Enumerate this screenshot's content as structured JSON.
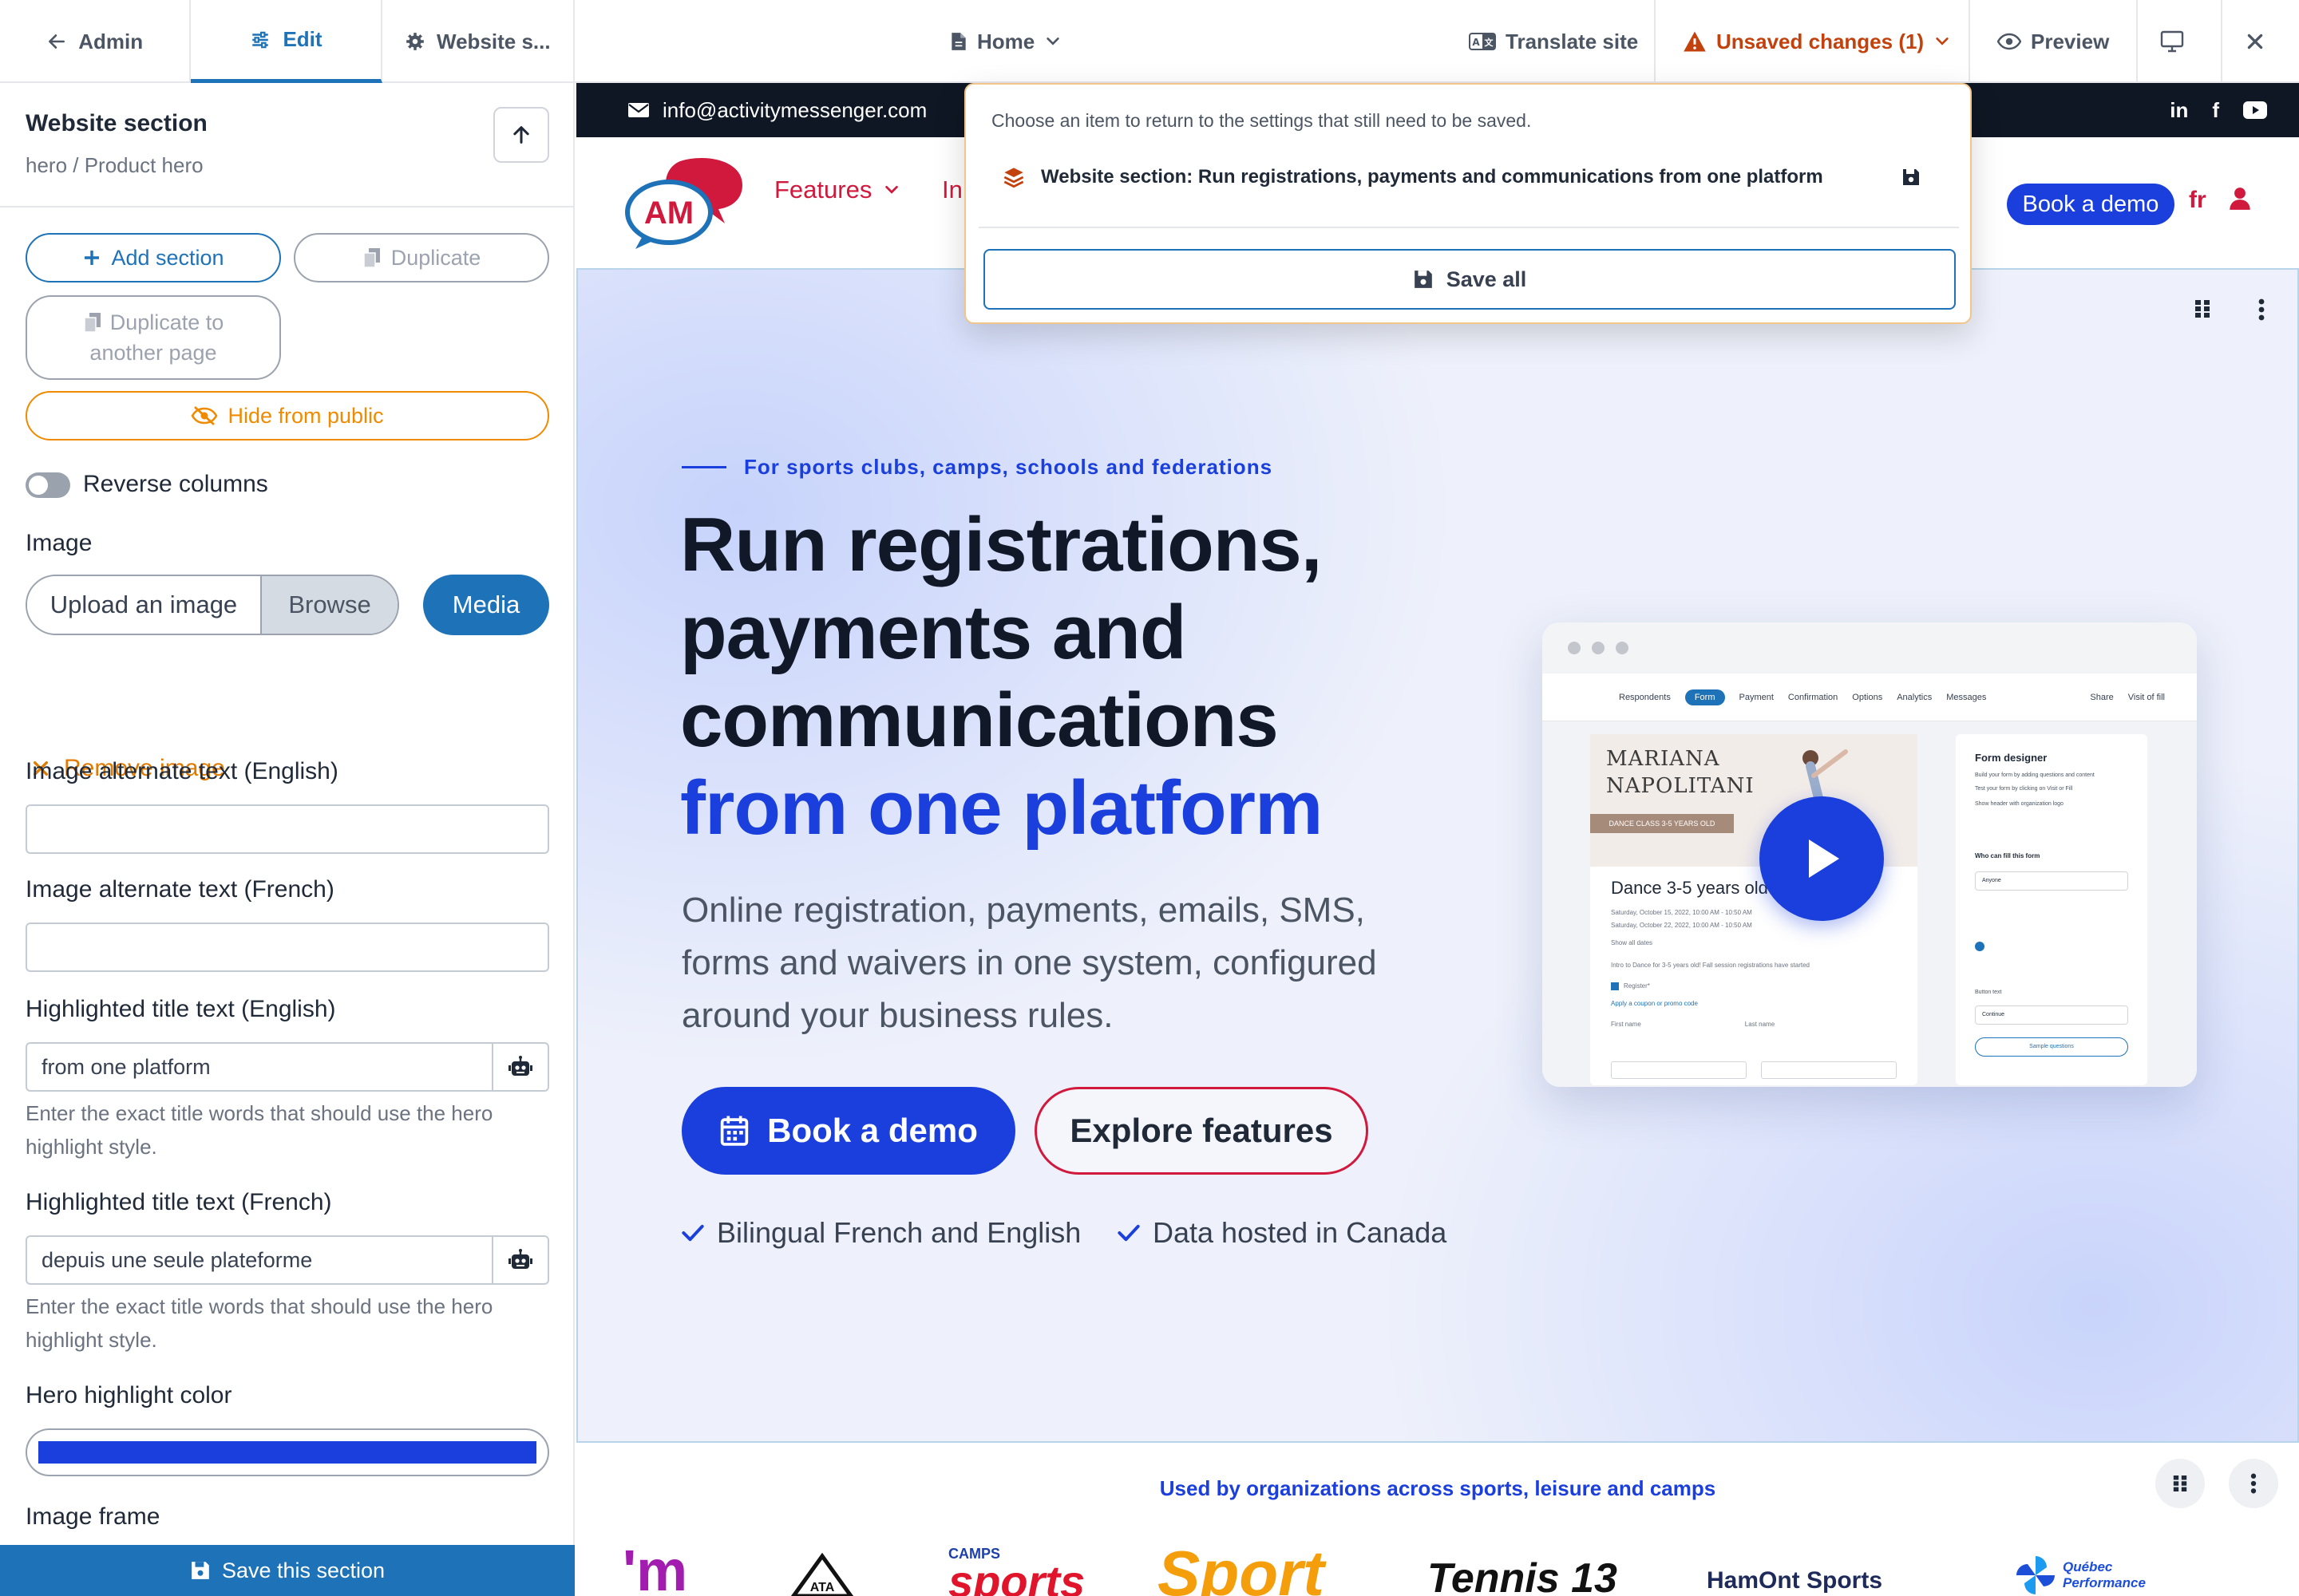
{
  "topbar": {
    "tabs": [
      {
        "label": "Admin",
        "icon": "arrow-left-icon"
      },
      {
        "label": "Edit",
        "icon": "sliders-icon"
      },
      {
        "label": "Website s...",
        "icon": "gear-icon"
      }
    ],
    "page_selector": "Home",
    "translate_label": "Translate site",
    "unsaved_label": "Unsaved changes (1)",
    "preview_label": "Preview"
  },
  "panel": {
    "title": "Website section",
    "subtitle": "hero / Product hero",
    "add_section": "Add section",
    "duplicate": "Duplicate",
    "duplicate_to_line1": "Duplicate to",
    "duplicate_to_line2": "another page",
    "hide_public": "Hide from public",
    "reverse_columns": "Reverse columns",
    "image_label": "Image",
    "upload_image": "Upload an image",
    "browse": "Browse",
    "media": "Media",
    "remove_image": "Remove image",
    "alt_en_label": "Image alternate text (English)",
    "alt_en_value": "",
    "alt_fr_label": "Image alternate text (French)",
    "alt_fr_value": "",
    "hl_en_label": "Highlighted title text (English)",
    "hl_en_value": "from one platform",
    "hl_help_line1": "Enter the exact title words that should use the hero",
    "hl_help_line2": "highlight style.",
    "hl_fr_label": "Highlighted title text (French)",
    "hl_fr_value": "depuis une seule plateforme",
    "color_label": "Hero highlight color",
    "color_value": "#1a3fdc",
    "frame_label": "Image frame",
    "save_section": "Save this section"
  },
  "site": {
    "email": "info@activitymessenger.com",
    "social": [
      "in",
      "f",
      "youtube-icon"
    ],
    "logo_text": "AM",
    "nav_features": "Features",
    "nav_in": "In",
    "nav_demo": "Book a demo",
    "nav_lang": "fr",
    "hero": {
      "eyebrow": "For sports clubs, camps, schools and federations",
      "title_line1": "Run registrations,",
      "title_line2": "payments and",
      "title_line3": "communications",
      "title_highlight": "from one platform",
      "desc_line1": "Online registration, payments, emails, SMS,",
      "desc_line2": "forms and waivers in one system, configured",
      "desc_line3": "around your business rules.",
      "cta_primary": "Book a demo",
      "cta_secondary": "Explore features",
      "check1": "Bilingual French and English",
      "check2": "Data hosted in Canada"
    },
    "mock": {
      "nav": [
        "Respondents",
        "Form",
        "Payment",
        "Confirmation",
        "Options",
        "Analytics",
        "Messages"
      ],
      "share": "Share",
      "visit": "Visit of fill",
      "card_name1": "MARIANA",
      "card_name2": "NAPOLITANI",
      "card_badge": "DANCE CLASS 3-5 YEARS OLD",
      "card_title": "Dance 3-5 years old",
      "card_date1": "Saturday, October 15, 2022, 10:00 AM - 10:50 AM",
      "card_date2": "Saturday, October 22, 2022, 10:00 AM - 10:50 AM",
      "show_all": "Show all dates",
      "intro": "Intro to Dance for 3-5 years old! Fall session registrations have started",
      "register": "Register*",
      "coupon": "Apply a coupon or promo code",
      "first_name": "First name",
      "last_name": "Last name",
      "side_title": "Form designer",
      "side_b1": "Build your form by adding questions and content",
      "side_b2": "Test your form by clicking on Visit or Fill",
      "side_b3": "Show header with organization logo",
      "side_who": "Who can fill this form",
      "side_anyone": "Anyone",
      "side_button": "Button text",
      "side_continue": "Continue",
      "side_sample": "Sample questions"
    },
    "logos_caption": "Used by organizations across sports, leisure and camps",
    "logos": [
      "'m",
      "ATA",
      "sports",
      "Sport",
      "Tennis 13",
      "HamOnt Sports",
      "Québec Performance"
    ],
    "logo_camps": "CAMPS"
  },
  "dropdown": {
    "hint": "Choose an item to return to the settings that still need to be saved.",
    "item": "Website section: Run registrations, payments and communications from one platform",
    "save_all": "Save all"
  },
  "colors": {
    "accent": "#1d72b8",
    "brand_blue": "#1a3fdc",
    "brand_red": "#d0193c",
    "warning": "#f08a00"
  }
}
